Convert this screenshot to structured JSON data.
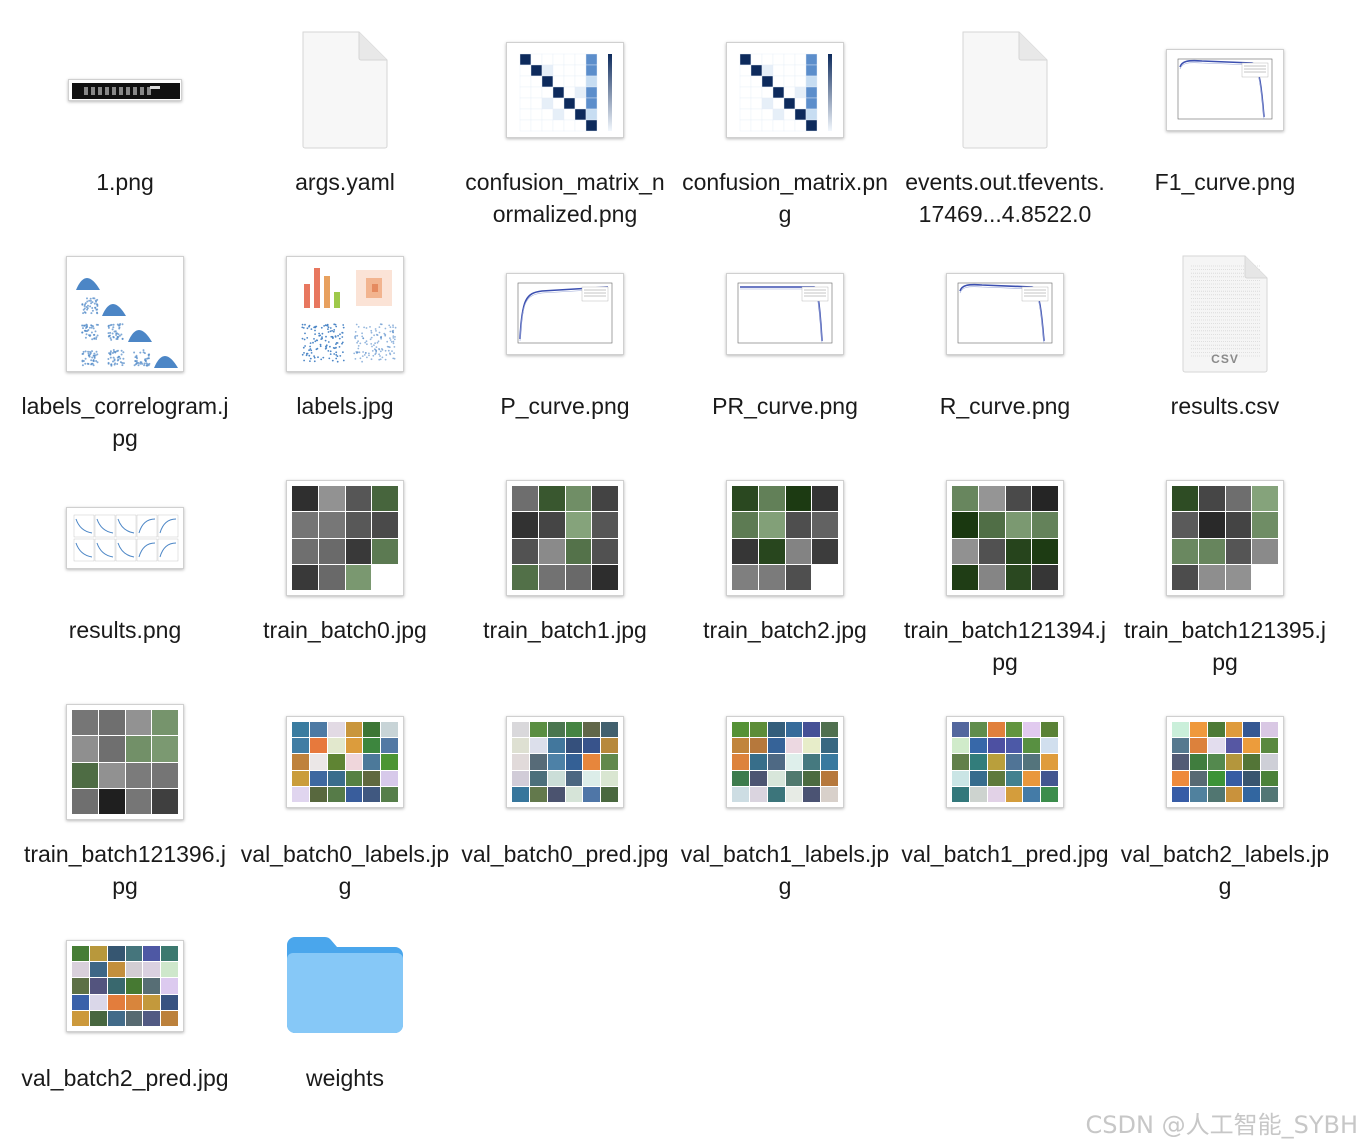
{
  "files": [
    {
      "name": "1.png",
      "kind": "strip",
      "icon": "image-thumbnail"
    },
    {
      "name": "args.yaml",
      "kind": "doc",
      "icon": "document-icon"
    },
    {
      "name": "confusion_matrix_normalized.png",
      "kind": "matrix",
      "icon": "image-thumbnail"
    },
    {
      "name": "confusion_matrix.png",
      "kind": "matrix",
      "icon": "image-thumbnail"
    },
    {
      "name": "events.out.tfevents.17469...4.8522.0",
      "kind": "doc",
      "icon": "document-icon"
    },
    {
      "name": "F1_curve.png",
      "kind": "curve-down",
      "icon": "image-thumbnail"
    },
    {
      "name": "labels_correlogram.jpg",
      "kind": "correlogram",
      "icon": "image-thumbnail"
    },
    {
      "name": "labels.jpg",
      "kind": "labels",
      "icon": "image-thumbnail"
    },
    {
      "name": "P_curve.png",
      "kind": "curve-up",
      "icon": "image-thumbnail"
    },
    {
      "name": "PR_curve.png",
      "kind": "curve-pr",
      "icon": "image-thumbnail"
    },
    {
      "name": "R_curve.png",
      "kind": "curve-down",
      "icon": "image-thumbnail"
    },
    {
      "name": "results.csv",
      "kind": "csv",
      "icon": "csv-document-icon",
      "tag": "CSV"
    },
    {
      "name": "results.png",
      "kind": "results",
      "icon": "image-thumbnail"
    },
    {
      "name": "train_batch0.jpg",
      "kind": "train",
      "icon": "image-thumbnail"
    },
    {
      "name": "train_batch1.jpg",
      "kind": "train",
      "icon": "image-thumbnail"
    },
    {
      "name": "train_batch2.jpg",
      "kind": "train",
      "icon": "image-thumbnail"
    },
    {
      "name": "train_batch121394.jpg",
      "kind": "train",
      "icon": "image-thumbnail"
    },
    {
      "name": "train_batch121395.jpg",
      "kind": "train",
      "icon": "image-thumbnail"
    },
    {
      "name": "train_batch121396.jpg",
      "kind": "train",
      "icon": "image-thumbnail"
    },
    {
      "name": "val_batch0_labels.jpg",
      "kind": "val",
      "icon": "image-thumbnail"
    },
    {
      "name": "val_batch0_pred.jpg",
      "kind": "val",
      "icon": "image-thumbnail"
    },
    {
      "name": "val_batch1_labels.jpg",
      "kind": "val",
      "icon": "image-thumbnail"
    },
    {
      "name": "val_batch1_pred.jpg",
      "kind": "val",
      "icon": "image-thumbnail"
    },
    {
      "name": "val_batch2_labels.jpg",
      "kind": "val",
      "icon": "image-thumbnail"
    },
    {
      "name": "val_batch2_pred.jpg",
      "kind": "val",
      "icon": "image-thumbnail"
    },
    {
      "name": "weights",
      "kind": "folder",
      "icon": "folder-icon"
    }
  ],
  "watermark": "CSDN @人工智能_SYBH",
  "colors": {
    "folder_back": "#4aa6ec",
    "folder_front": "#86c8f7",
    "plot_line": "#3b4fb0",
    "matrix_dark": "#0d2a5c",
    "matrix_light": "#c7ddf2",
    "bar_red": "#e8775f",
    "bar_green": "#9ec94a",
    "scatter_blue": "#4c86c6"
  }
}
